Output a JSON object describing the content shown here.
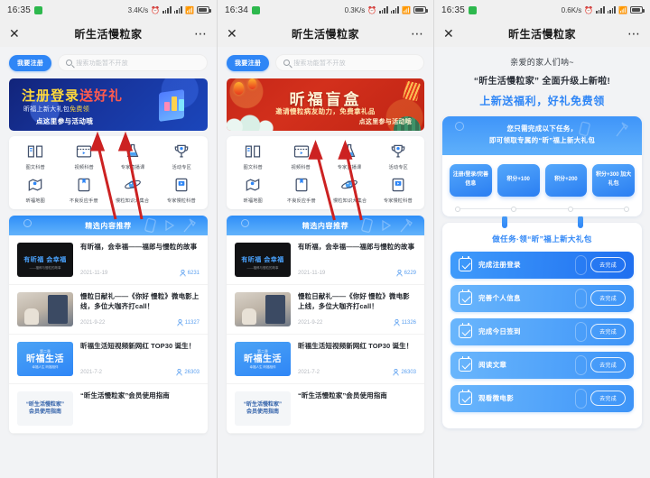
{
  "app": {
    "title": "昕生活慢粒家",
    "close_icon": "close-icon",
    "more_icon": "more-options-icon"
  },
  "panels": [
    {
      "status": {
        "time": "16:35",
        "speed": "3.4K/s",
        "icons": [
          "alarm-icon",
          "signal-icon",
          "signal-icon",
          "wifi-icon",
          "battery-icon"
        ]
      },
      "search": {
        "register_button": "我要注册",
        "placeholder": "搜索功能暂不开放",
        "icon": "search-icon"
      },
      "banner": {
        "type": "blue",
        "line1_a": "注册登录",
        "line1_b": "送好礼",
        "line2_a": "昕福上新大礼包",
        "line2_b": "免费领",
        "line3": "点这里参与活动哦"
      },
      "grid": [
        {
          "label": "图文科普",
          "icon": "book-icon"
        },
        {
          "label": "视频科普",
          "icon": "video-icon"
        },
        {
          "label": "专家直播课",
          "icon": "live-icon"
        },
        {
          "label": "活动专区",
          "icon": "trophy-icon"
        },
        {
          "label": "昕福地图",
          "icon": "map-pin-icon"
        },
        {
          "label": "不良反应手册",
          "icon": "manual-icon"
        },
        {
          "label": "慢粒知识大集合",
          "icon": "planet-icon"
        },
        {
          "label": "专家慢粒科普",
          "icon": "play-book-icon"
        }
      ],
      "recommend": {
        "header": "精选内容推荐",
        "items": [
          {
            "title": "有昕福，会幸福——福郎与慢粒的故事",
            "date": "2021-11-19",
            "views": "6231",
            "thumb_kind": "dark",
            "thumb_title": "有昕福 会幸福",
            "thumb_sub": "——福郎与慢粒的故事"
          },
          {
            "title": "慢粒日献礼——《你好 慢粒》微电影上线，多位大咖齐打call！",
            "date": "2021-9-22",
            "views": "11327",
            "thumb_kind": "photo",
            "thumb_title": "",
            "thumb_sub": ""
          },
          {
            "title": "昕福生活短视频新网红 TOP30 诞生！",
            "date": "2021-7-2",
            "views": "26303",
            "thumb_kind": "blue",
            "thumb_title": "昕福生活",
            "thumb_top": "第二季",
            "thumb_sub": "幸福人生 昕福相伴"
          },
          {
            "title": "“昕生活慢粒家”会员使用指南",
            "date": "",
            "views": "",
            "thumb_kind": "guide",
            "thumb_title": "“昕生活慢粒家”\n会员使用指南",
            "thumb_sub": ""
          }
        ]
      }
    },
    {
      "status": {
        "time": "16:34",
        "speed": "0.3K/s"
      },
      "search": {
        "register_button": "我要注册",
        "placeholder": "搜索功能暂不开放"
      },
      "banner": {
        "type": "red",
        "title": "昕福盲盒",
        "subtitle": "邀请慢粒病友助力，免费拿礼品",
        "cta": "点这里参与活动哦"
      },
      "recommend": {
        "header": "精选内容推荐",
        "items": [
          {
            "title": "有昕福，会幸福——福郎与慢粒的故事",
            "date": "2021-11-19",
            "views": "6229"
          },
          {
            "title": "慢粒日献礼——《你好 慢粒》微电影上线，多位大咖齐打call！",
            "date": "2021-9-22",
            "views": "11326"
          },
          {
            "title": "昕福生活短视频新网红 TOP30 诞生！",
            "date": "2021-7-2",
            "views": "26303"
          },
          {
            "title": "“昕生活慢粒家”会员使用指南",
            "date": "",
            "views": ""
          }
        ]
      }
    },
    {
      "status": {
        "time": "16:35",
        "speed": "0.6K/s"
      },
      "promo": {
        "line1": "亲爱的家人们呐~",
        "line2": "“昕生活慢粒家” 全面升级上新啦!",
        "line3": "上新送福利，好礼免费领"
      },
      "reward_card": {
        "head_line1": "您只需完成以下任务，",
        "head_line2": "即可领取专属的“昕”福上新大礼包",
        "tiles": [
          "注册/登录/完善信息",
          "积分+100",
          "积分+200",
          "积分+300 加大礼包"
        ]
      },
      "tasks_card": {
        "title": "做任务·领“昕”福上新大礼包",
        "action_label": "去完成",
        "items": [
          {
            "name": "完成注册登录",
            "style": "dark"
          },
          {
            "name": "完善个人信息",
            "style": "light"
          },
          {
            "name": "完成今日签到",
            "style": "light"
          },
          {
            "name": "阅读文章",
            "style": "light"
          },
          {
            "name": "观看微电影",
            "style": "light"
          }
        ]
      }
    }
  ],
  "colors": {
    "accent": "#2f86f6",
    "banner_blue": "#17359e",
    "banner_red": "#c62718",
    "arrow_red": "#cc2222",
    "yellow": "#ffd93b"
  }
}
